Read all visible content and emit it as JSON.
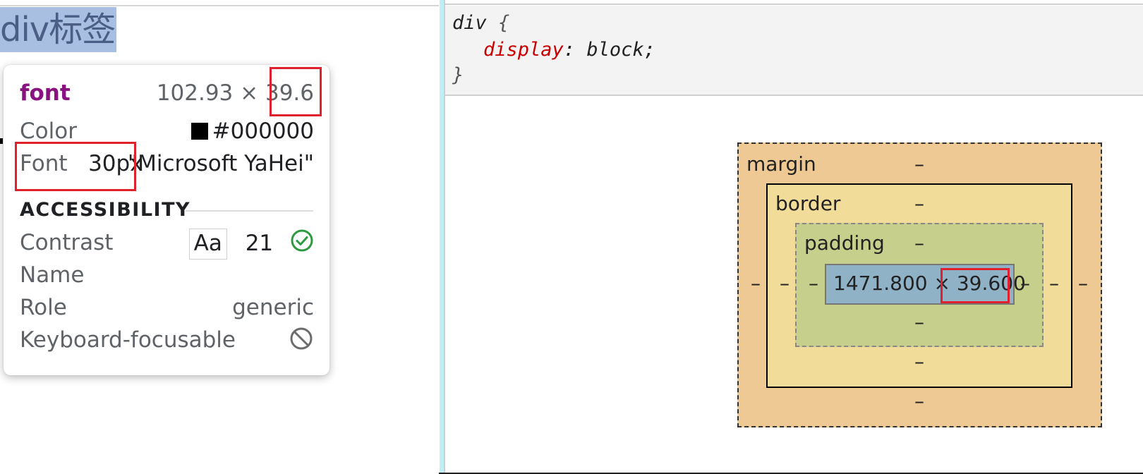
{
  "page": {
    "heading": "div标签"
  },
  "tooltip": {
    "tag": "font",
    "dimensions": "102.93 × 39.6",
    "color_label": "Color",
    "color_value": "#000000",
    "font_label": "Font",
    "font_size": "30px",
    "font_family": "\"Microsoft YaHei\"",
    "accessibility_title": "ACCESSIBILITY",
    "contrast_label": "Contrast",
    "contrast_sample": "Aa",
    "contrast_value": "21",
    "name_label": "Name",
    "role_label": "Role",
    "role_value": "generic",
    "keyboard_label": "Keyboard-focusable",
    "icons": {
      "contrast_status": "check-circle-icon",
      "keyboard_status": "not-allowed-icon"
    }
  },
  "styles": {
    "selector": "div",
    "open_brace": "{",
    "property": "display",
    "value": "block;",
    "close_brace": "}"
  },
  "box_model": {
    "margin_label": "margin",
    "border_label": "border",
    "padding_label": "padding",
    "content_size": "1471.800 × 39.600",
    "margin_top": "–",
    "margin_bottom": "–",
    "margin_left": "–",
    "margin_right": "–",
    "border_top": "–",
    "border_bottom": "–",
    "border_left": "–",
    "border_right": "–",
    "padding_top": "–",
    "padding_bottom": "–",
    "padding_left": "–",
    "padding_right": "–"
  },
  "colors": {
    "highlight": "#e0212d",
    "tag": "#881280",
    "property": "#c80000",
    "margin": "#eec994",
    "border": "#f2dc99",
    "padding": "#c6cf8c",
    "content": "#8fb2c7"
  }
}
